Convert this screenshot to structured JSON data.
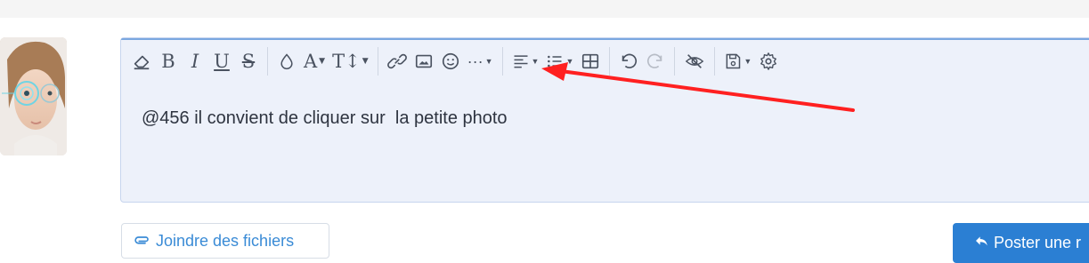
{
  "editor": {
    "content": "@456 il convient de cliquer sur  la petite photo",
    "toolbar": {
      "bold_label": "B",
      "italic_label": "I",
      "underline_label": "U",
      "strike_label": "S",
      "font_family_label": "A",
      "font_size_label": "T↕",
      "more_label": "···"
    }
  },
  "actions": {
    "attach_label": "Joindre des fichiers",
    "post_label": "Poster une r"
  },
  "annotation": {
    "arrow_color": "#ff2020"
  },
  "colors": {
    "accent": "#2b7fd3",
    "link": "#3a8bd6",
    "editor_bg": "#edf1fa"
  }
}
